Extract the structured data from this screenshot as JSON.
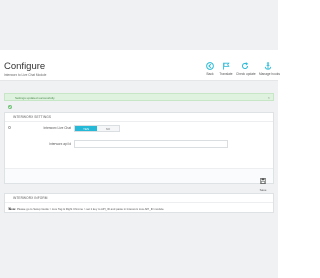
{
  "header": {
    "title": "Configure",
    "breadcrumb": "Interworx to Live Chat Module"
  },
  "toolbar": {
    "buttons": [
      {
        "label": "Back",
        "icon": "back-icon"
      },
      {
        "label": "Translate",
        "icon": "flag-icon"
      },
      {
        "label": "Check update",
        "icon": "refresh-icon"
      },
      {
        "label": "Manage hooks",
        "icon": "anchor-icon"
      }
    ]
  },
  "alert": {
    "text": "Settings updated successfully."
  },
  "settings_panel": {
    "heading": "INTERWORX SETTINGS",
    "fields": [
      {
        "label": "Interworx Live Chat",
        "type": "toggle",
        "options": [
          "YES",
          "NO"
        ],
        "selected": "YES"
      },
      {
        "label": "Interworx api Id",
        "type": "text",
        "value": ""
      }
    ],
    "save_label": "Save"
  },
  "info_panel": {
    "heading": "INTERWORX INFORM",
    "note_label": "Note:",
    "note_text": "Please go to Setup Guide > Live Tag & Right Chrome > set it key to API_ID and paste in Interworx Live API_ID module."
  },
  "colors": {
    "accent": "#25b9d7",
    "success_bg": "#dff2df",
    "page_bg": "#eff1f2"
  }
}
